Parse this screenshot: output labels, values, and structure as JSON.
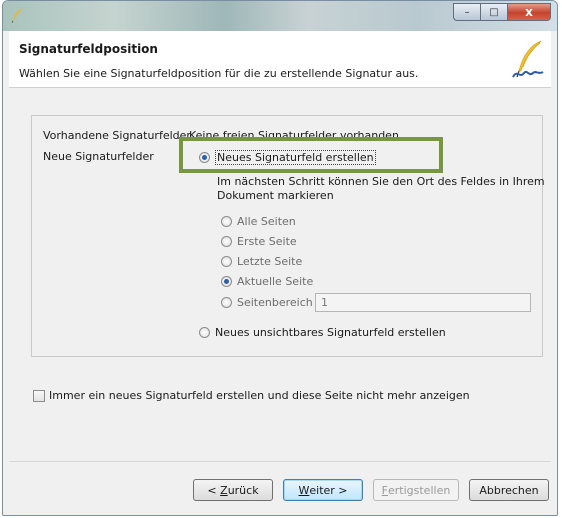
{
  "window": {
    "title_bar": {
      "minimize": "–",
      "maximize": "□",
      "close": "x"
    }
  },
  "header": {
    "title": "Signaturfeldposition",
    "subtitle": "Wählen Sie eine Signaturfeldposition für die zu erstellende Signatur aus."
  },
  "form": {
    "existing_label": "Vorhandene Signaturfelder",
    "existing_value": "Keine freien Signaturfelder vorhanden",
    "new_label": "Neue Signaturfelder",
    "radio_new_visible": "Neues Signaturfeld erstellen",
    "hint_line1": "Im nächsten Schritt können Sie den Ort des Feldes in Ihrem",
    "hint_line2": "Dokument markieren",
    "page_options": [
      {
        "label": "Alle Seiten",
        "selected": false
      },
      {
        "label": "Erste Seite",
        "selected": false
      },
      {
        "label": "Letzte Seite",
        "selected": false
      },
      {
        "label": "Aktuelle Seite",
        "selected": true
      },
      {
        "label": "Seitenbereich",
        "selected": false
      }
    ],
    "page_range_value": "1",
    "radio_new_invisible": "Neues unsichtbares Signaturfeld erstellen"
  },
  "checkbox": {
    "label": "Immer ein neues Signaturfeld erstellen und diese Seite nicht mehr anzeigen",
    "checked": false
  },
  "buttons": {
    "back_pre": "< ",
    "back_key": "Z",
    "back_post": "urück",
    "next_key": "W",
    "next_post": "eiter >",
    "finish_key": "F",
    "finish_post": "ertigstellen",
    "cancel": "Abbrechen"
  },
  "colors": {
    "highlight": "#77973e",
    "radio_selected": "#2d5ea8",
    "default_button": "#bee6fd"
  }
}
